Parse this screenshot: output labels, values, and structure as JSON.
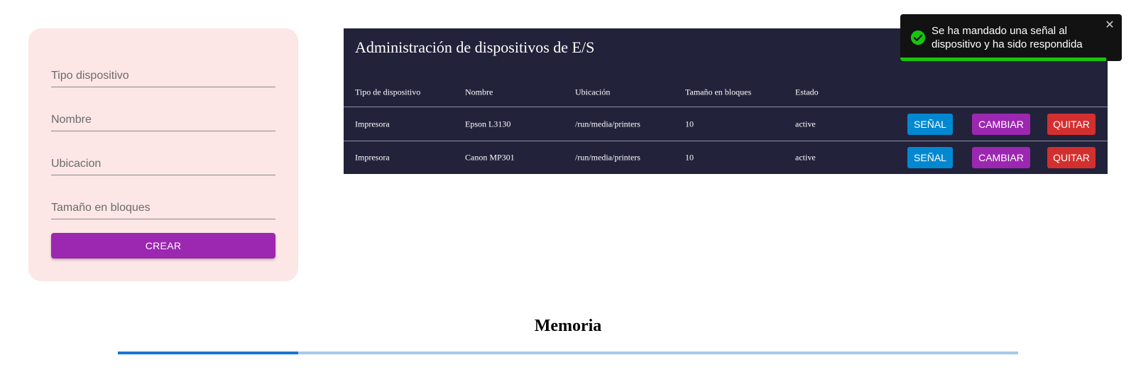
{
  "form": {
    "tipo_placeholder": "Tipo dispositivo",
    "nombre_placeholder": "Nombre",
    "ubicacion_placeholder": "Ubicacion",
    "tamano_placeholder": "Tamaño en bloques",
    "create_label": "CREAR"
  },
  "table": {
    "title": "Administración de dispositivos de E/S",
    "headers": [
      "Tipo de dispositivo",
      "Nombre",
      "Ubicación",
      "Tamaño en bloques",
      "Estado"
    ],
    "rows": [
      {
        "tipo": "Impresora",
        "nombre": "Epson L3130",
        "ubicacion": "/run/media/printers",
        "tamano": "10",
        "estado": "active"
      },
      {
        "tipo": "Impresora",
        "nombre": "Canon MP301",
        "ubicacion": "/run/media/printers",
        "tamano": "10",
        "estado": "active"
      }
    ],
    "actions": {
      "signal_label": "SEÑAL",
      "change_label": "CAMBIAR",
      "remove_label": "QUITAR"
    }
  },
  "memoria": {
    "title": "Memoria",
    "progress": 0.2
  },
  "toast": {
    "message": "Se ha mandado una señal al dispositivo y ha sido respondida",
    "close_glyph": "✕",
    "timer_remaining": 0.93,
    "icon": "check-circle-icon"
  },
  "colors": {
    "primary_purple": "#9c27b0",
    "signal_blue": "#0288d1",
    "remove_red": "#d32f2f",
    "table_bg": "#22223b",
    "form_bg": "#fde6e6",
    "success_green": "#16c60c",
    "progress_fill": "#1976d2",
    "progress_track": "#a6cbe9"
  }
}
